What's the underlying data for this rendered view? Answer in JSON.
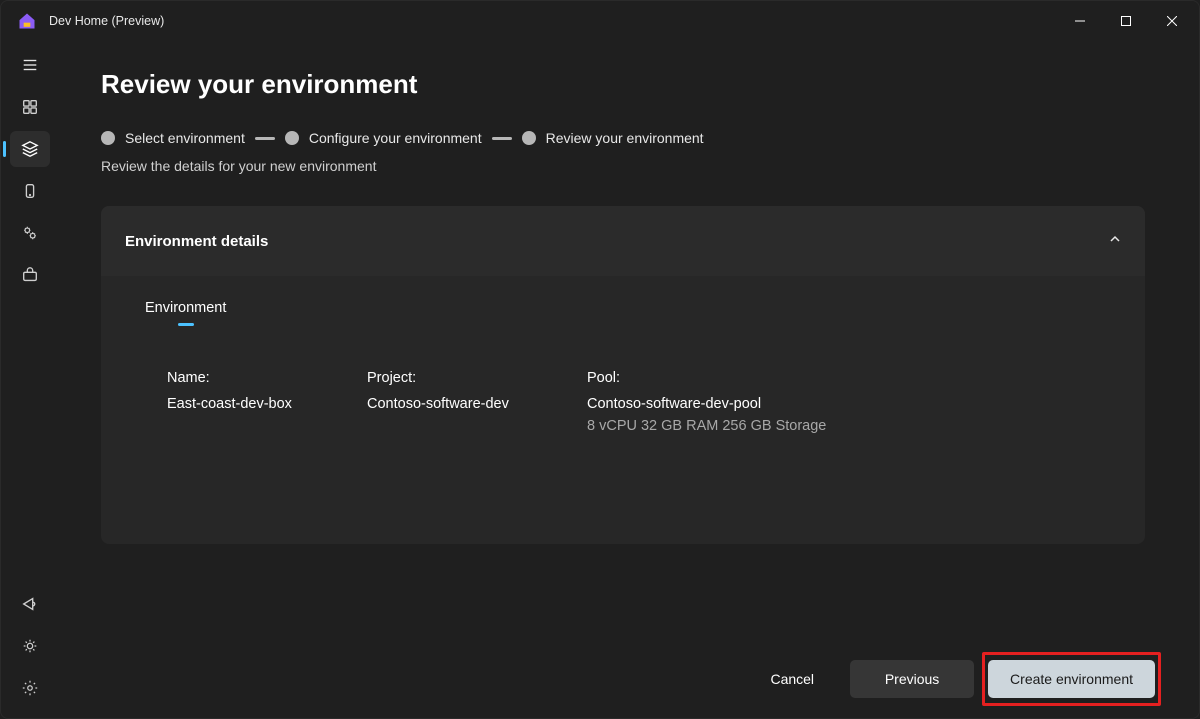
{
  "app": {
    "title": "Dev Home (Preview)"
  },
  "page": {
    "title": "Review your environment",
    "subtext": "Review the details for your new environment"
  },
  "stepper": {
    "step1": "Select environment",
    "step2": "Configure your environment",
    "step3": "Review your environment"
  },
  "card": {
    "title": "Environment details",
    "tab": "Environment",
    "fields": {
      "name_label": "Name:",
      "name_value": "East-coast-dev-box",
      "project_label": "Project:",
      "project_value": "Contoso-software-dev",
      "pool_label": "Pool:",
      "pool_value": "Contoso-software-dev-pool",
      "pool_spec": "8 vCPU 32 GB RAM 256 GB Storage"
    }
  },
  "footer": {
    "cancel": "Cancel",
    "previous": "Previous",
    "create": "Create environment"
  }
}
